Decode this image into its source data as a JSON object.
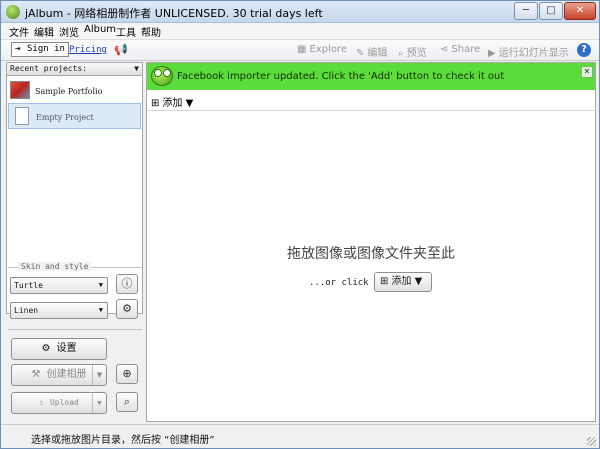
{
  "window": {
    "title": "jAlbum - 网络相册制作者 UNLICENSED. 30 trial days left",
    "minimize_glyph": "─",
    "maximize_glyph": "□",
    "close_glyph": "✕"
  },
  "menu": {
    "items": [
      "文件",
      "编辑",
      "浏览",
      "Album",
      "工具",
      "帮助"
    ]
  },
  "toolbar": {
    "signin_label": "Sign in",
    "pricing_label": "Pricing",
    "explore_label": "Explore",
    "edit_label": "编辑",
    "preview_label": "预览",
    "share_label": "Share",
    "slideshow_label": "运行幻灯片显示",
    "help_glyph": "?"
  },
  "projects": {
    "header": "Recent projects:",
    "items": [
      {
        "label": "Sample Portfolio"
      },
      {
        "label": "Empty Project"
      }
    ]
  },
  "skin": {
    "section_title": "Skin and style",
    "skin_value": "Turtle",
    "style_value": "Linen"
  },
  "buttons": {
    "settings_label": "设置",
    "build_label": "创建相册",
    "upload_label": "Upload"
  },
  "notification": {
    "text": "Facebook importer updated. Click the 'Add' button to check it out",
    "close_glyph": "✕"
  },
  "main": {
    "add_label": "添加",
    "drop_text": "拖放图像或图像文件夹至此",
    "or_click": "...or click",
    "add_button_label": "添加"
  },
  "status": {
    "text": "选择或拖放图片目录，然后按 “创建相册”"
  },
  "colors": {
    "notification_bg": "#5bdc3b",
    "link": "#1f3fc4",
    "selection": "#dbe9f8"
  }
}
